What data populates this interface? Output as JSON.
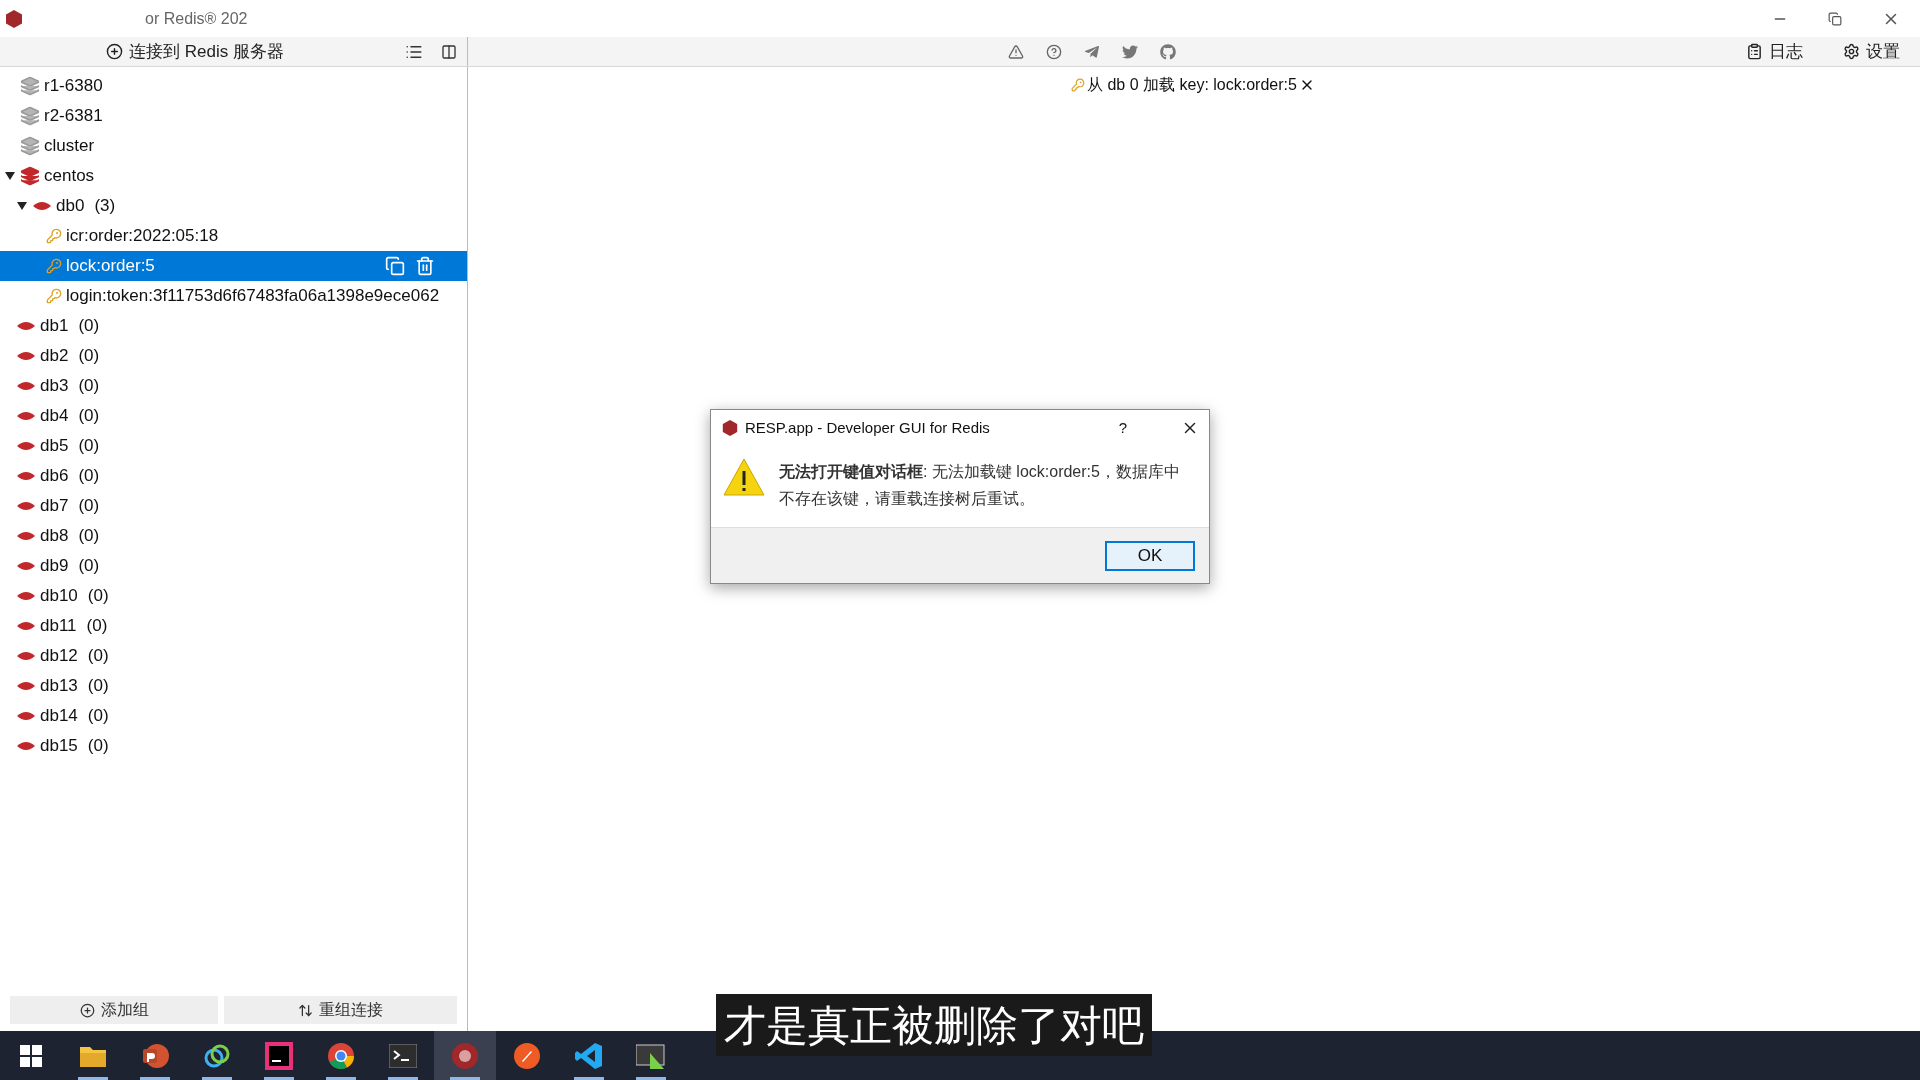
{
  "window": {
    "title": "or Redis® 202"
  },
  "toolbar": {
    "connect": "连接到 Redis 服务器",
    "log": "日志",
    "settings": "设置"
  },
  "tree": [
    {
      "name": "r1-6380",
      "connected": false
    },
    {
      "name": "r2-6381",
      "connected": false
    },
    {
      "name": "cluster",
      "connected": false
    },
    {
      "name": "centos",
      "connected": true,
      "children": [
        {
          "name": "db0",
          "count": "(3)",
          "children": [
            {
              "name": "icr:order:2022:05:18",
              "selected": false
            },
            {
              "name": "lock:order:5",
              "selected": true
            },
            {
              "name": "login:token:3f11753d6f67483fa06a1398e9ece062",
              "selected": false
            }
          ]
        },
        {
          "name": "db1",
          "count": "(0)"
        },
        {
          "name": "db2",
          "count": "(0)"
        },
        {
          "name": "db3",
          "count": "(0)"
        },
        {
          "name": "db4",
          "count": "(0)"
        },
        {
          "name": "db5",
          "count": "(0)"
        },
        {
          "name": "db6",
          "count": "(0)"
        },
        {
          "name": "db7",
          "count": "(0)"
        },
        {
          "name": "db8",
          "count": "(0)"
        },
        {
          "name": "db9",
          "count": "(0)"
        },
        {
          "name": "db10",
          "count": "(0)"
        },
        {
          "name": "db11",
          "count": "(0)"
        },
        {
          "name": "db12",
          "count": "(0)"
        },
        {
          "name": "db13",
          "count": "(0)"
        },
        {
          "name": "db14",
          "count": "(0)"
        },
        {
          "name": "db15",
          "count": "(0)"
        }
      ]
    }
  ],
  "sidebar_buttons": [
    "添加组",
    "重组连接"
  ],
  "tab": {
    "label": "从 db 0 加载 key: lock:order:5"
  },
  "dialog": {
    "title": "RESP.app - Developer GUI for Redis",
    "help": "?",
    "message": "**无法打开键值对话框**: 无法加载键 lock:order:5，数据库中不存在该键，请重载连接树后重试。",
    "button": "OK"
  },
  "subtitle": "才是真正被删除了对吧",
  "taskbar": [
    {
      "kind": "start",
      "running": false,
      "active": false
    },
    {
      "kind": "folder",
      "running": true,
      "active": false
    },
    {
      "kind": "slides",
      "running": true,
      "active": false
    },
    {
      "kind": "ring",
      "running": true,
      "active": false
    },
    {
      "kind": "ide",
      "running": true,
      "active": false
    },
    {
      "kind": "browser",
      "running": true,
      "active": false
    },
    {
      "kind": "terminal",
      "running": true,
      "active": false
    },
    {
      "kind": "redis",
      "running": true,
      "active": true
    },
    {
      "kind": "compass",
      "running": false,
      "active": false
    },
    {
      "kind": "code",
      "running": true,
      "active": false
    },
    {
      "kind": "screen",
      "running": true,
      "active": false
    }
  ]
}
